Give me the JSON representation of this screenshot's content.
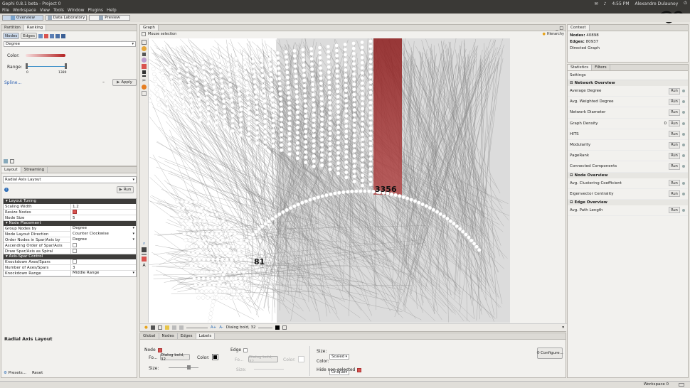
{
  "window": {
    "title": "Gephi 0.8.1 beta - Project 0",
    "time": "4:55 PM",
    "user": "Alexandre Dulaunoy"
  },
  "menu": [
    "File",
    "Workspace",
    "View",
    "Tools",
    "Window",
    "Plugins",
    "Help"
  ],
  "workspace_tabs": [
    "Overview",
    "Data Laboratory",
    "Preview"
  ],
  "partition": {
    "tabs": [
      "Partition",
      "Ranking"
    ],
    "subtabs": [
      "Nodes",
      "Edges"
    ],
    "ranking_param": "Degree",
    "color_label": "Color:",
    "range_label": "Range:",
    "range_min": "0",
    "range_max": "1389",
    "spline_link": "Spline...",
    "apply_label": "Apply"
  },
  "layout": {
    "tabs": [
      "Layout",
      "Streaming"
    ],
    "algorithm": "Radial Axis Layout",
    "run_label": "Run",
    "groups": [
      {
        "name": "Layout Tuning",
        "rows": [
          {
            "k": "Scaling Width",
            "v": "1.2"
          },
          {
            "k": "Resize Nodes",
            "v": ""
          },
          {
            "k": "Node Size",
            "v": "5"
          }
        ]
      },
      {
        "name": "Node Placement",
        "rows": [
          {
            "k": "Group Nodes by",
            "v": "Degree"
          },
          {
            "k": "Node Layout Direction",
            "v": "Counter Clockwise"
          },
          {
            "k": "Order Nodes in Spar/Axis by",
            "v": "Degree"
          },
          {
            "k": "Ascending Order of Spar/Axis",
            "v": ""
          },
          {
            "k": "Draw Spar/Axis as Spiral",
            "v": ""
          }
        ]
      },
      {
        "name": "Axis-Spar Control",
        "rows": [
          {
            "k": "Knockdown Axes/Spars",
            "v": ""
          },
          {
            "k": "Number of Axes/Spars",
            "v": "3"
          },
          {
            "k": "Knockdown Range",
            "v": "Middle Range"
          }
        ]
      }
    ],
    "description_title": "Radial Axis Layout",
    "presets_label": "Presets...",
    "reset_label": "Reset"
  },
  "graph": {
    "tab": "Graph",
    "mode": "Mouse selection",
    "hierarchy": "Hierarchy",
    "node_labels": [
      "3356",
      "81"
    ],
    "font_label": "Dialog bold, 32"
  },
  "bottom": {
    "tabs": [
      "Global",
      "Nodes",
      "Edges",
      "Labels"
    ],
    "node_label": "Node",
    "edge_label": "Edge",
    "font_prefix": "Fo...",
    "node_font": "Dialog bold, 32",
    "edge_font": "Dialog bold, 32",
    "color_label": "Color:",
    "size_label": "Size:",
    "size_mode": "Scaled",
    "color_mode": "Unique",
    "hide_label": "Hide non-selected",
    "configure": "Configure..."
  },
  "context": {
    "tab": "Context",
    "nodes_label": "Nodes:",
    "nodes": "40898",
    "edges_label": "Edges:",
    "edges": "80937",
    "type": "Directed Graph"
  },
  "statistics": {
    "tabs": [
      "Statistics",
      "Filters"
    ],
    "settings": "Settings",
    "run_label": "Run",
    "sections": [
      {
        "title": "Network Overview",
        "items": [
          {
            "name": "Average Degree",
            "val": ""
          },
          {
            "name": "Avg. Weighted Degree",
            "val": ""
          },
          {
            "name": "Network Diameter",
            "val": ""
          },
          {
            "name": "Graph Density",
            "val": "0"
          },
          {
            "name": "HITS",
            "val": ""
          },
          {
            "name": "Modularity",
            "val": ""
          },
          {
            "name": "PageRank",
            "val": ""
          },
          {
            "name": "Connected Components",
            "val": ""
          }
        ]
      },
      {
        "title": "Node Overview",
        "items": [
          {
            "name": "Avg. Clustering Coefficient",
            "val": ""
          },
          {
            "name": "Eigenvector Centrality",
            "val": ""
          }
        ]
      },
      {
        "title": "Edge Overview",
        "items": [
          {
            "name": "Avg. Path Length",
            "val": ""
          }
        ]
      }
    ]
  },
  "statusbar": {
    "workspace": "Workspace 0"
  },
  "colors": {
    "accent_red": "#9b1c1c",
    "node": "#ffffff",
    "edge": "#8a8a8a"
  }
}
